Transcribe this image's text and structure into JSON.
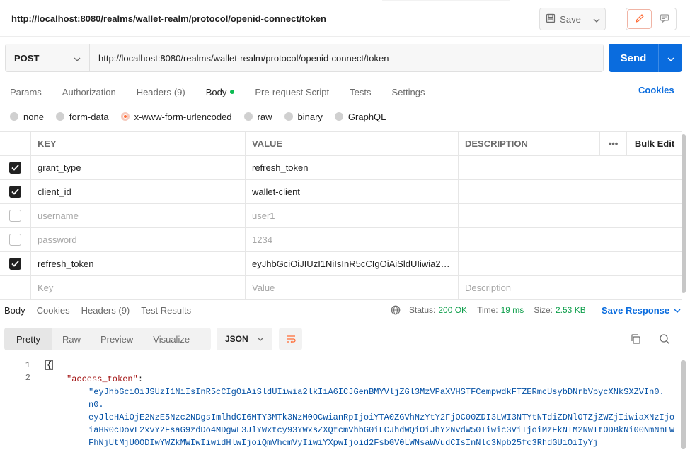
{
  "title": {
    "url": "http://localhost:8080/realms/wallet-realm/protocol/openid-connect/token"
  },
  "toolbar": {
    "save_label": "Save"
  },
  "request": {
    "method": "POST",
    "url": "http://localhost:8080/realms/wallet-realm/protocol/openid-connect/token",
    "send_label": "Send"
  },
  "req_tabs": {
    "params": "Params",
    "authorization": "Authorization",
    "headers": "Headers",
    "headers_count": "(9)",
    "body": "Body",
    "prerequest": "Pre-request Script",
    "tests": "Tests",
    "settings": "Settings",
    "cookies": "Cookies"
  },
  "body_types": {
    "none": "none",
    "form_data": "form-data",
    "urlencoded": "x-www-form-urlencoded",
    "raw": "raw",
    "binary": "binary",
    "graphql": "GraphQL",
    "selected": "x-www-form-urlencoded"
  },
  "params_table": {
    "headers": {
      "key": "KEY",
      "value": "VALUE",
      "description": "DESCRIPTION",
      "more": "•••",
      "bulk": "Bulk Edit"
    },
    "rows": [
      {
        "key": "grant_type",
        "value": "refresh_token",
        "checked": true
      },
      {
        "key": "client_id",
        "value": "wallet-client",
        "checked": true
      },
      {
        "key": "username",
        "value": "user1",
        "checked": false
      },
      {
        "key": "password",
        "value": "1234",
        "checked": false
      },
      {
        "key": "refresh_token",
        "value": "eyJhbGciOiJIUzI1NiIsInR5cCIgOiAiSldUIiwia2lkI...",
        "checked": true
      }
    ],
    "placeholders": {
      "key": "Key",
      "value": "Value",
      "description": "Description"
    }
  },
  "resp_tabs": {
    "body": "Body",
    "cookies": "Cookies",
    "headers": "Headers",
    "headers_count": "(9)",
    "test_results": "Test Results"
  },
  "resp_status": {
    "status_label": "Status:",
    "status_value": "200 OK",
    "time_label": "Time:",
    "time_value": "19 ms",
    "size_label": "Size:",
    "size_value": "2.53 KB",
    "save_response": "Save Response"
  },
  "resp_toolbar": {
    "pretty": "Pretty",
    "raw": "Raw",
    "preview": "Preview",
    "visualize": "Visualize",
    "lang": "JSON"
  },
  "code": {
    "line_numbers": [
      "1",
      "2"
    ],
    "open_brace": "{",
    "key": "\"access_token\"",
    "colon": ":",
    "token_lines": [
      "\"eyJhbGciOiJSUzI1NiIsInR5cCIgOiAiSldUIiwia2lkIiA6ICJGenBMYVljZGl3MzVPaXVHSTFCempwdkFTZERmcUsybDNrbVpycXNkSXZVIn0.",
      "eyJleHAiOjE2NzE5Nzc2NDgsImlhdCI6MTY3MTk3NzM0OCwianRpIjoiYTA0ZGVhNzYtY2FjOC00ZDI3LWI3NTYtNTdiZDNlOTZjZWZjIiwiaXNzIjoiaHR0cDovL2xvY2FsaG9zdDo4MDgwL3JlYWxtcy93YWxsZXQtcmVhbG0iLCJhdWQiOiJhY2NvdW50Iiwic3ViIjoiMzFkNTM2NWItODBkNi00NmNmLWFhNjUtMjU0ODIwYWZkMWIwIiwidHlwIjoiQmVhcmVyIiwiYXpwIjoid2FsbGV0LWNsaWVudCIsInNlc3Npb25fc3RhdGUiOiIyYj",
      "Mi00NmNmLWFhNjUtMjU0ODIwYWZkMWIwIiwidHlwIjoiQmVhcmVyIiwiYXpwIjoid2FsbGV0LWNsaWVudCIsInNlc3Npb25fc3RhdGUiOiIyYj"
    ]
  },
  "colors": {
    "accent": "#0a6cde",
    "brand_orange": "#ff6c37",
    "success": "#0d9e4a"
  }
}
